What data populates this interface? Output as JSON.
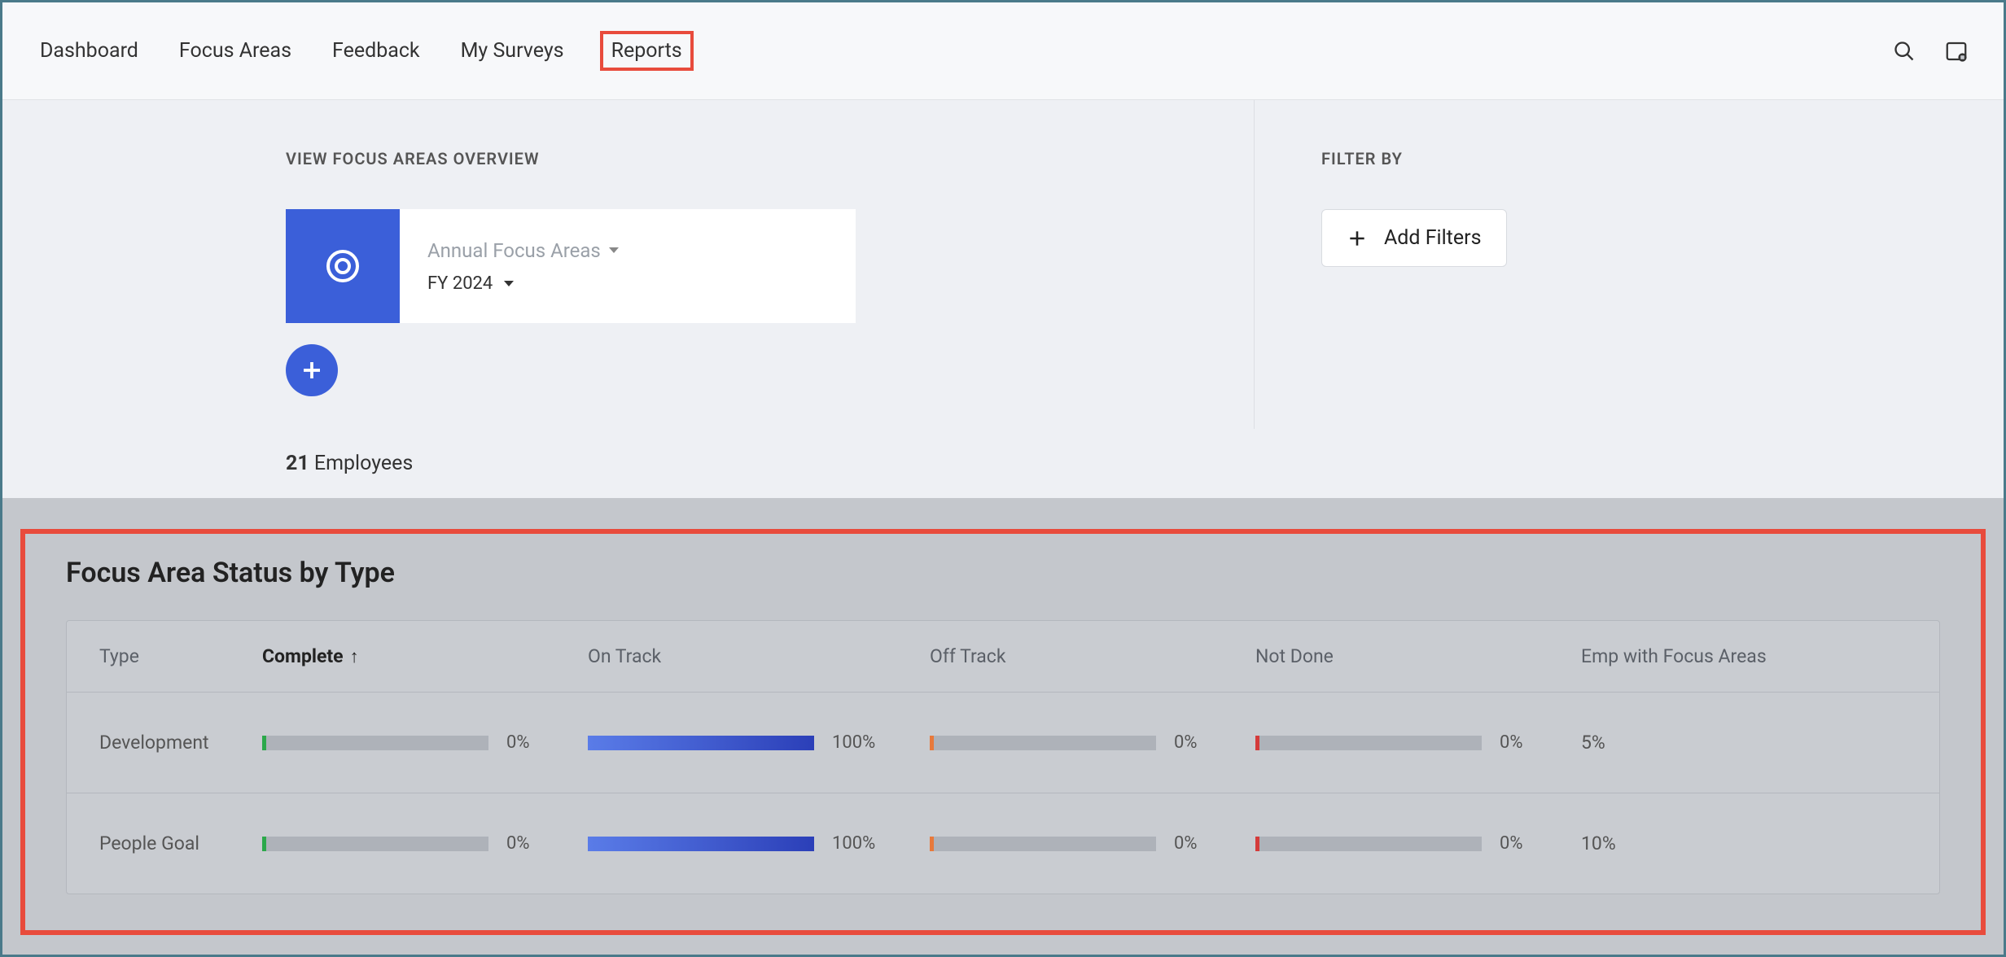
{
  "nav": {
    "items": [
      "Dashboard",
      "Focus Areas",
      "Feedback",
      "My Surveys",
      "Reports"
    ],
    "highlighted_index": 4
  },
  "overview": {
    "label": "VIEW FOCUS AREAS OVERVIEW",
    "card_title": "Annual Focus Areas",
    "card_subtitle": "FY 2024"
  },
  "filter": {
    "label": "FILTER BY",
    "button": "Add Filters"
  },
  "emp_count": {
    "count": "21",
    "label": "Employees"
  },
  "chart_data": {
    "type": "table",
    "title": "Focus Area Status by Type",
    "columns": [
      "Type",
      "Complete",
      "On Track",
      "Off Track",
      "Not Done",
      "Emp with Focus Areas"
    ],
    "sorted_column": "Complete",
    "sort_dir": "asc",
    "rows": [
      {
        "type": "Development",
        "complete": {
          "pct": 0,
          "label": "0%",
          "color": "green"
        },
        "on_track": {
          "pct": 100,
          "label": "100%",
          "color": "blue"
        },
        "off_track": {
          "pct": 0,
          "label": "0%",
          "color": "orange"
        },
        "not_done": {
          "pct": 0,
          "label": "0%",
          "color": "red"
        },
        "emp": "5%"
      },
      {
        "type": "People Goal",
        "complete": {
          "pct": 0,
          "label": "0%",
          "color": "green"
        },
        "on_track": {
          "pct": 100,
          "label": "100%",
          "color": "blue"
        },
        "off_track": {
          "pct": 0,
          "label": "0%",
          "color": "orange"
        },
        "not_done": {
          "pct": 0,
          "label": "0%",
          "color": "red"
        },
        "emp": "10%"
      }
    ]
  }
}
